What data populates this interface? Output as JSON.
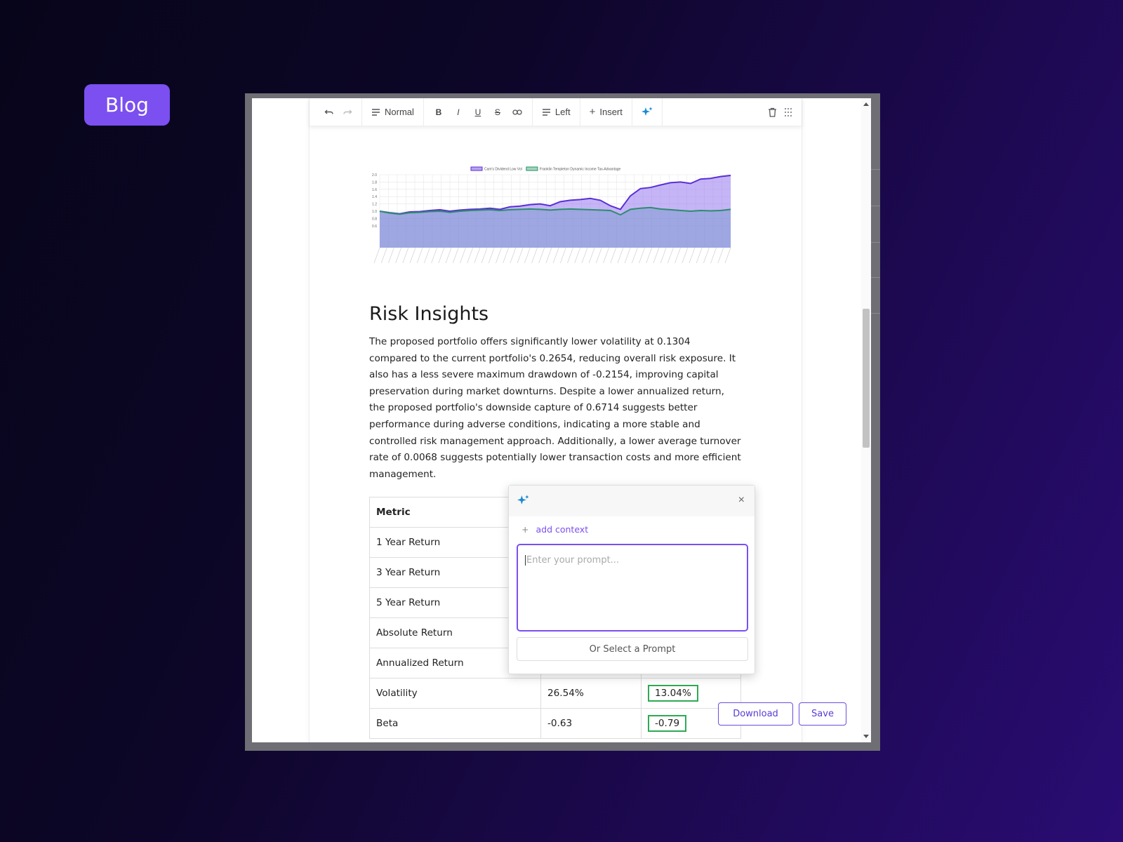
{
  "badge": {
    "label": "Blog"
  },
  "toolbar": {
    "style_label": "Normal",
    "bold": "B",
    "italic": "I",
    "underline": "U",
    "strike": "S",
    "align_label": "Left",
    "insert_label": "Insert"
  },
  "chart_data": {
    "type": "area",
    "legend": [
      "Cam's Dividend Low Vol",
      "Franklin Templeton Dynamic Income Tax-Advantage"
    ],
    "ylim": [
      0,
      2.0
    ],
    "yticks": [
      "2.0",
      "1.8",
      "1.6",
      "1.4",
      "1.2",
      "1.0",
      "0.8",
      "0.6"
    ],
    "series": [
      {
        "name": "Cam's Dividend Low Vol",
        "color": "#5b2fd6",
        "values": [
          1.0,
          0.96,
          0.93,
          0.98,
          0.99,
          1.02,
          1.04,
          1.0,
          1.03,
          1.05,
          1.06,
          1.08,
          1.05,
          1.12,
          1.14,
          1.18,
          1.2,
          1.15,
          1.26,
          1.3,
          1.32,
          1.35,
          1.3,
          1.15,
          1.05,
          1.42,
          1.62,
          1.65,
          1.72,
          1.78,
          1.8,
          1.76,
          1.88,
          1.9,
          1.95,
          1.98
        ]
      },
      {
        "name": "Franklin Templeton Dynamic Income Tax-Advantage",
        "color": "#2e8b6e",
        "values": [
          1.0,
          0.95,
          0.92,
          0.96,
          0.97,
          0.99,
          1.0,
          0.97,
          1.0,
          1.02,
          1.03,
          1.04,
          1.02,
          1.04,
          1.05,
          1.06,
          1.05,
          1.03,
          1.05,
          1.06,
          1.05,
          1.04,
          1.03,
          1.02,
          0.9,
          1.05,
          1.08,
          1.1,
          1.06,
          1.04,
          1.02,
          1.0,
          1.02,
          1.01,
          1.02,
          1.05
        ]
      }
    ]
  },
  "content": {
    "heading": "Risk Insights",
    "paragraph": "The proposed portfolio offers significantly lower volatility at 0.1304 compared to the current portfolio's 0.2654, reducing overall risk exposure. It also has a less severe maximum drawdown of -0.2154, improving capital preservation during market downturns. Despite a lower annualized return, the proposed portfolio's downside capture of 0.6714 suggests better performance during adverse conditions, indicating a more stable and controlled risk management approach. Additionally, a lower average turnover rate of 0.0068 suggests potentially lower transaction costs and more efficient management."
  },
  "table": {
    "header": "Metric",
    "rows": [
      {
        "metric": "1 Year Return",
        "current": "",
        "proposed": ""
      },
      {
        "metric": "3 Year Return",
        "current": "",
        "proposed": ""
      },
      {
        "metric": "5 Year Return",
        "current": "",
        "proposed": ""
      },
      {
        "metric": "Absolute Return",
        "current": "",
        "proposed": ""
      },
      {
        "metric": "Annualized Return",
        "current": "",
        "proposed": ""
      },
      {
        "metric": "Volatility",
        "current": "26.54%",
        "proposed": "13.04%"
      },
      {
        "metric": "Beta",
        "current": "-0.63",
        "proposed": "-0.79"
      }
    ]
  },
  "popup": {
    "add_context": "add context",
    "placeholder": "Enter your prompt...",
    "select_prompt": "Or Select a Prompt"
  },
  "actions": {
    "download": "Download",
    "save": "Save"
  }
}
